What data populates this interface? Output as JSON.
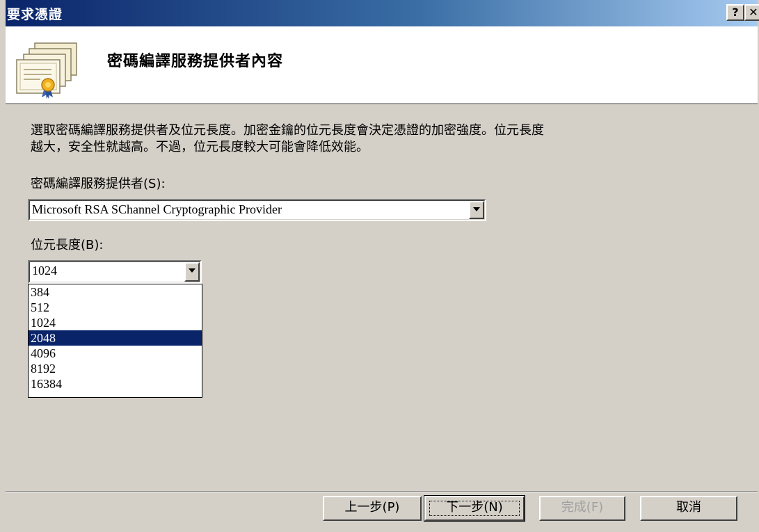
{
  "window": {
    "title": "要求憑證"
  },
  "titlebar": {
    "help_label": "?",
    "close_label": "✕"
  },
  "header": {
    "title": "密碼編譯服務提供者內容",
    "icon": "certificate-icon"
  },
  "description": {
    "line1": "選取密碼編譯服務提供者及位元長度。加密金鑰的位元長度會決定憑證的加密強度。位元長度",
    "line2": "越大，安全性就越高。不過，位元長度較大可能會降低效能。"
  },
  "provider": {
    "label": "密碼編譯服務提供者(S):",
    "value": "Microsoft RSA SChannel Cryptographic Provider"
  },
  "bit_length": {
    "label": "位元長度(B):",
    "value": "1024",
    "options": [
      "384",
      "512",
      "1024",
      "2048",
      "4096",
      "8192",
      "16384"
    ],
    "highlighted": "2048"
  },
  "buttons": {
    "back": "上一步(P)",
    "next": "下一步(N)",
    "finish": "完成(F)",
    "cancel": "取消"
  },
  "colors": {
    "titlebar": "#0a246a",
    "face": "#d4d0c8",
    "selection": "#0a246a"
  }
}
